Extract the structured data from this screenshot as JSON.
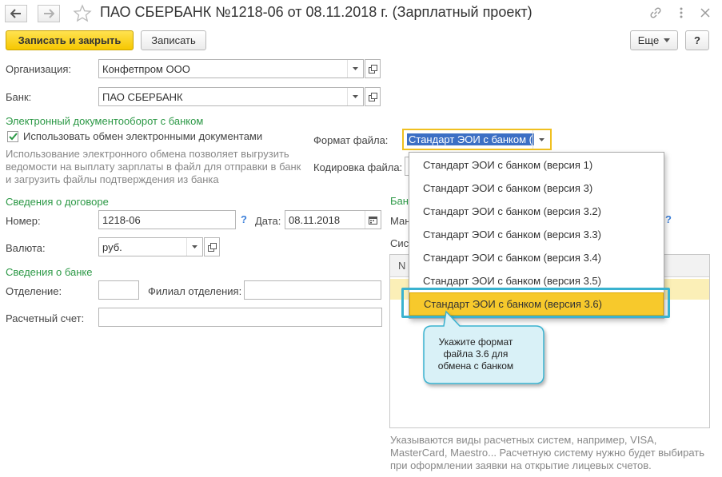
{
  "window": {
    "title": "ПАО СБЕРБАНК №1218-06 от 08.11.2018 г. (Зарплатный проект)"
  },
  "toolbar": {
    "save_close": "Записать и закрыть",
    "save": "Записать",
    "more": "Еще",
    "help": "?"
  },
  "form": {
    "organization_label": "Организация:",
    "organization_value": "Конфетпром ООО",
    "bank_label": "Банк:",
    "bank_value": "ПАО СБЕРБАНК",
    "edo_section": "Электронный документооборот с банком",
    "edo_checkbox_label": "Использовать обмен электронными документами",
    "edo_checked": true,
    "edo_hint": "Использование электронного обмена позволяет выгрузить ведомости на выплату зарплаты в файл для отправки в банк и загрузить файлы подтверждения из банка",
    "file_format_label": "Формат файла:",
    "file_format_value": "Стандарт ЭОИ с банком (",
    "encoding_label": "Кодировка файла:",
    "contract_section": "Сведения о договоре",
    "number_label": "Номер:",
    "number_value": "1218-06",
    "date_label": "Дата:",
    "date_value": "08.11.2018",
    "currency_label": "Валюта:",
    "currency_value": "руб.",
    "bank_info_section": "Сведения о банке",
    "branch_label": "Отделение:",
    "branch_value": "",
    "sub_branch_label": "Филиал отделения:",
    "sub_branch_value": "",
    "account_label": "Расчетный счет:",
    "account_value": "",
    "question_mark": "?"
  },
  "right_panel": {
    "section_partial": "Бан",
    "label_partial": "Ман",
    "systems_partial": "Сис",
    "table_col_partial": "N",
    "question_mark": "?",
    "footer_hint": "Указываются виды расчетных систем, например, VISA, MasterCard, Maestro... Расчетную систему нужно будет выбирать при оформлении заявки на открытие лицевых счетов."
  },
  "dropdown": {
    "options": [
      "Стандарт ЭОИ с банком (версия 1)",
      "Стандарт ЭОИ с банком (версия 3)",
      "Стандарт ЭОИ с банком (версия 3.2)",
      "Стандарт ЭОИ с банком (версия 3.3)",
      "Стандарт ЭОИ с банком (версия 3.4)",
      "Стандарт ЭОИ с банком (версия 3.5)",
      "Стандарт ЭОИ с банком (версия 3.6)"
    ],
    "selected_index": 6
  },
  "callout": {
    "text": "Укажите формат файла 3.6 для обмена с банком"
  },
  "colors": {
    "accent_green": "#2b9845",
    "primary_yellow": "#f6c700",
    "callout_blue": "#3ab2cf",
    "callout_fill": "#d9f1f7",
    "selected_item": "#f7c92c"
  }
}
